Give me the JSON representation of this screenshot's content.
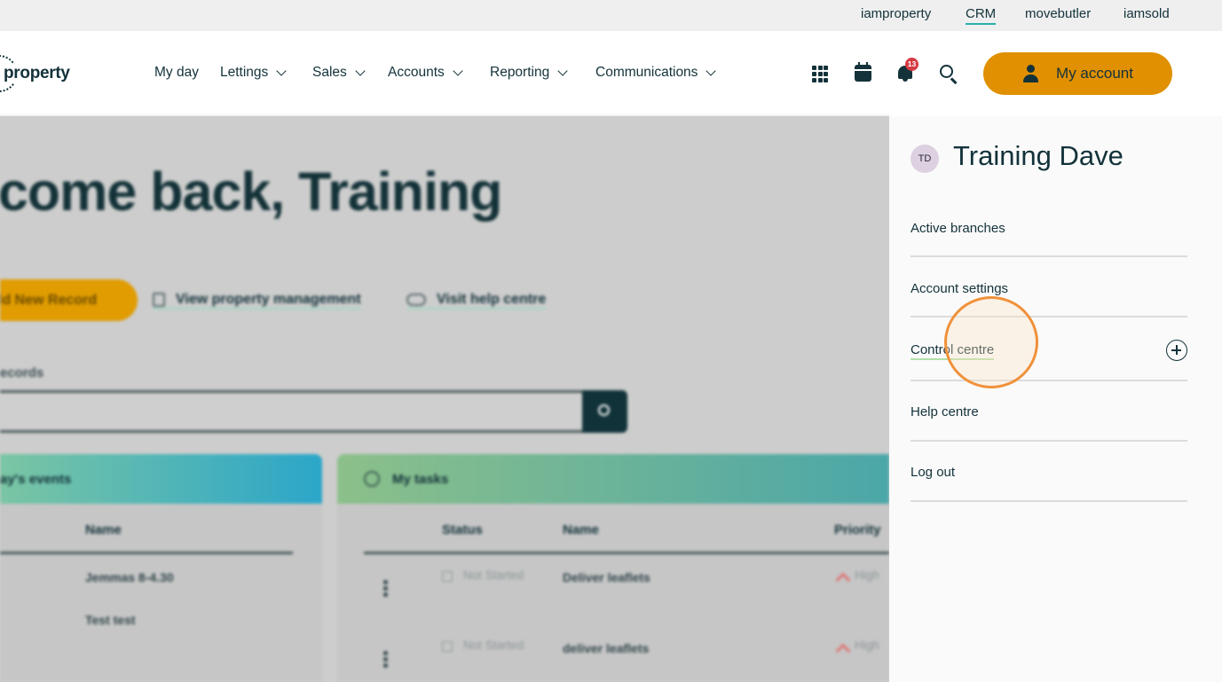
{
  "utility_bar": {
    "links": [
      "iamproperty",
      "CRM",
      "movebutler",
      "iamsold"
    ],
    "active_link": "CRM",
    "accent_color": "#2ab0a8"
  },
  "nav": {
    "logo_text": "property",
    "items": [
      {
        "label": "My day",
        "has_dropdown": false
      },
      {
        "label": "Lettings",
        "has_dropdown": true
      },
      {
        "label": "Sales",
        "has_dropdown": true
      },
      {
        "label": "Accounts",
        "has_dropdown": true
      },
      {
        "label": "Reporting",
        "has_dropdown": true
      },
      {
        "label": "Communications",
        "has_dropdown": true
      }
    ],
    "icons": [
      "apps-grid-icon",
      "calendar-icon",
      "bell-icon",
      "search-icon"
    ],
    "notification_count": "13",
    "account_button_label": "My account",
    "account_button_color": "#e09000"
  },
  "dashboard": {
    "welcome": "lcome back, Training",
    "add_record": "ld New Record",
    "links": [
      "View property management",
      "Visit help centre"
    ],
    "records_label": "ecords",
    "events_panel": {
      "title": "ay's events",
      "column": "Name",
      "rows": [
        "Jemmas 8-4.30",
        "Test test"
      ]
    },
    "tasks_panel": {
      "title": "My tasks",
      "columns": [
        "Status",
        "Name",
        "Priority"
      ],
      "rows": [
        {
          "status": "Not Started",
          "name": "Deliver leaflets",
          "priority": "High"
        },
        {
          "status": "Not Started",
          "name": "deliver leaflets",
          "priority": "High"
        }
      ]
    }
  },
  "drawer": {
    "initials": "TD",
    "user_name": "Training Dave",
    "items": [
      "Active branches",
      "Account settings",
      "Control centre",
      "Help centre",
      "Log out"
    ],
    "expandable_item": "Control centre"
  }
}
